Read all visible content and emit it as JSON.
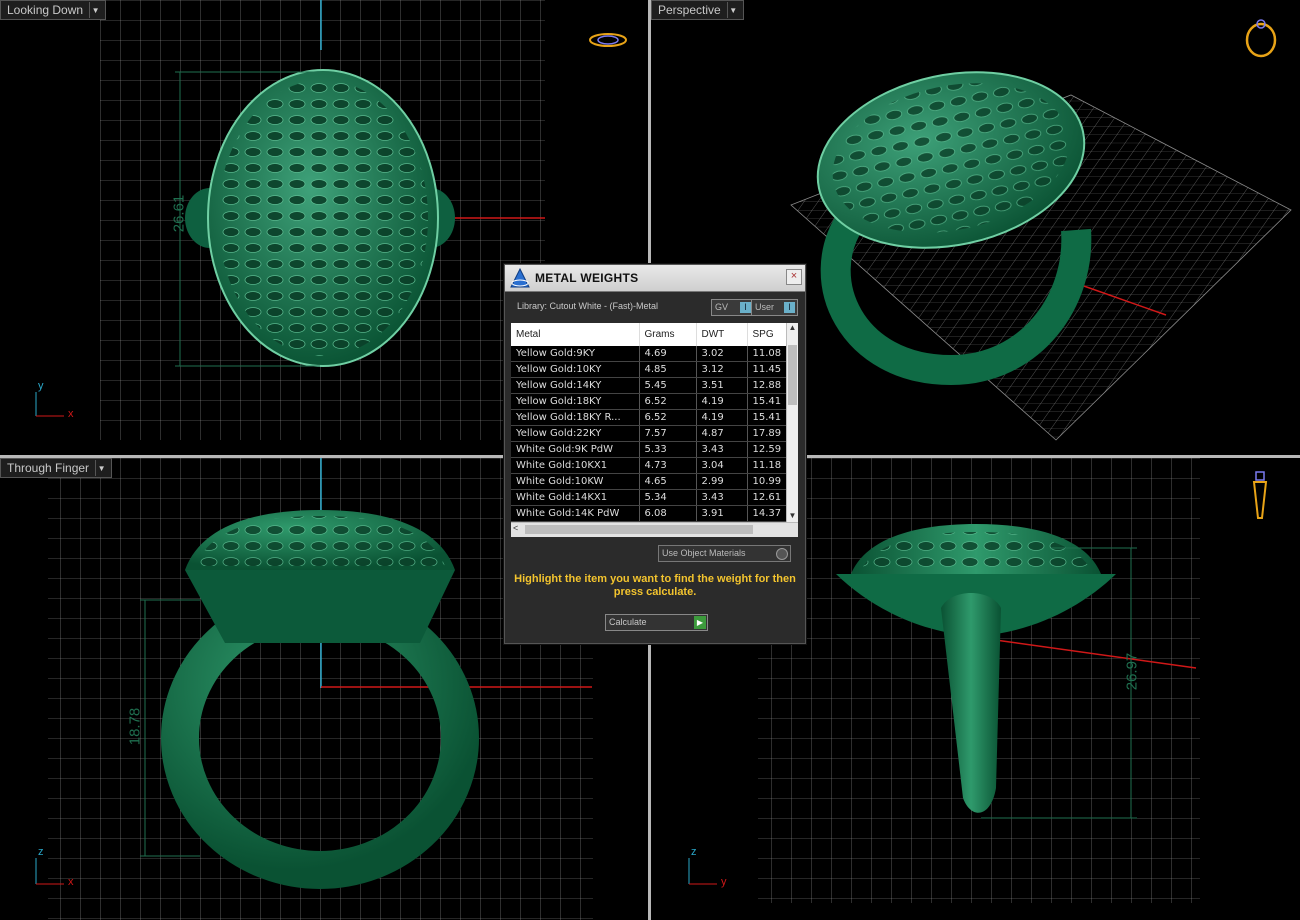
{
  "viewports": {
    "top_left": {
      "label": "Looking Down",
      "dimension": "26.61",
      "axis_v": "y",
      "axis_h": "x"
    },
    "top_right": {
      "label": "Perspective"
    },
    "bottom_left": {
      "label": "Through Finger",
      "dimension": "18.78",
      "axis_v": "z",
      "axis_h": "x"
    },
    "bottom_right": {
      "dimension": "26.97",
      "axis_v": "z",
      "axis_h": "y"
    }
  },
  "dialog": {
    "title": "METAL WEIGHTS",
    "close": "×",
    "library": "Library: Cutout White - (Fast)-Metal",
    "toggle_gv": "GV",
    "toggle_user": "User",
    "columns": [
      "Metal",
      "Grams",
      "DWT",
      "SPG"
    ],
    "rows": [
      [
        "Yellow Gold:9KY",
        "4.69",
        "3.02",
        "11.08"
      ],
      [
        "Yellow Gold:10KY",
        "4.85",
        "3.12",
        "11.45"
      ],
      [
        "Yellow Gold:14KY",
        "5.45",
        "3.51",
        "12.88"
      ],
      [
        "Yellow Gold:18KY",
        "6.52",
        "4.19",
        "15.41"
      ],
      [
        "Yellow Gold:18KY R...",
        "6.52",
        "4.19",
        "15.41"
      ],
      [
        "Yellow Gold:22KY",
        "7.57",
        "4.87",
        "17.89"
      ],
      [
        "White Gold:9K PdW",
        "5.33",
        "3.43",
        "12.59"
      ],
      [
        "White Gold:10KX1",
        "4.73",
        "3.04",
        "11.18"
      ],
      [
        "White Gold:10KW",
        "4.65",
        "2.99",
        "10.99"
      ],
      [
        "White Gold:14KX1",
        "5.34",
        "3.43",
        "12.61"
      ],
      [
        "White Gold:14K PdW",
        "6.08",
        "3.91",
        "14.37"
      ]
    ],
    "use_object_materials": "Use Object Materials",
    "hint": "Highlight the item you want to find the weight for then press calculate.",
    "calculate": "Calculate"
  },
  "colors": {
    "ring": "#0f6b45",
    "grid": "#bfbfbf",
    "axis_red": "#d01818",
    "axis_cyan": "#2aa7c9",
    "hint": "#f3c42e"
  }
}
